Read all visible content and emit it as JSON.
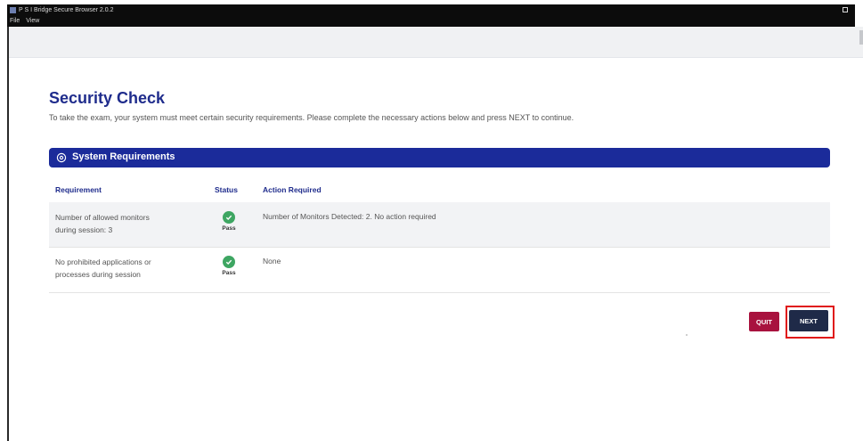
{
  "window": {
    "title": "P S I Bridge Secure Browser 2.0.2"
  },
  "menu": {
    "file": "File",
    "view": "View"
  },
  "page": {
    "title": "Security Check",
    "intro": "To take the exam, your system must meet certain security requirements. Please complete the necessary actions below and press NEXT to continue."
  },
  "section": {
    "title": "System Requirements",
    "icon": "gear-icon"
  },
  "table": {
    "headers": {
      "requirement": "Requirement",
      "status": "Status",
      "action": "Action Required"
    },
    "rows": [
      {
        "requirement_line1": "Number of allowed monitors",
        "requirement_line2": "during session: 3",
        "status": "Pass",
        "action": "Number of Monitors Detected: 2. No action required"
      },
      {
        "requirement_line1": "No prohibited applications or",
        "requirement_line2": "processes during session",
        "status": "Pass",
        "action": "None"
      }
    ]
  },
  "buttons": {
    "quit": "QUIT",
    "next": "NEXT"
  },
  "colors": {
    "brand": "#1b2b9a",
    "quit": "#a8123e",
    "next": "#1f2a48",
    "pass": "#3ea662",
    "highlight": "#e01616"
  }
}
